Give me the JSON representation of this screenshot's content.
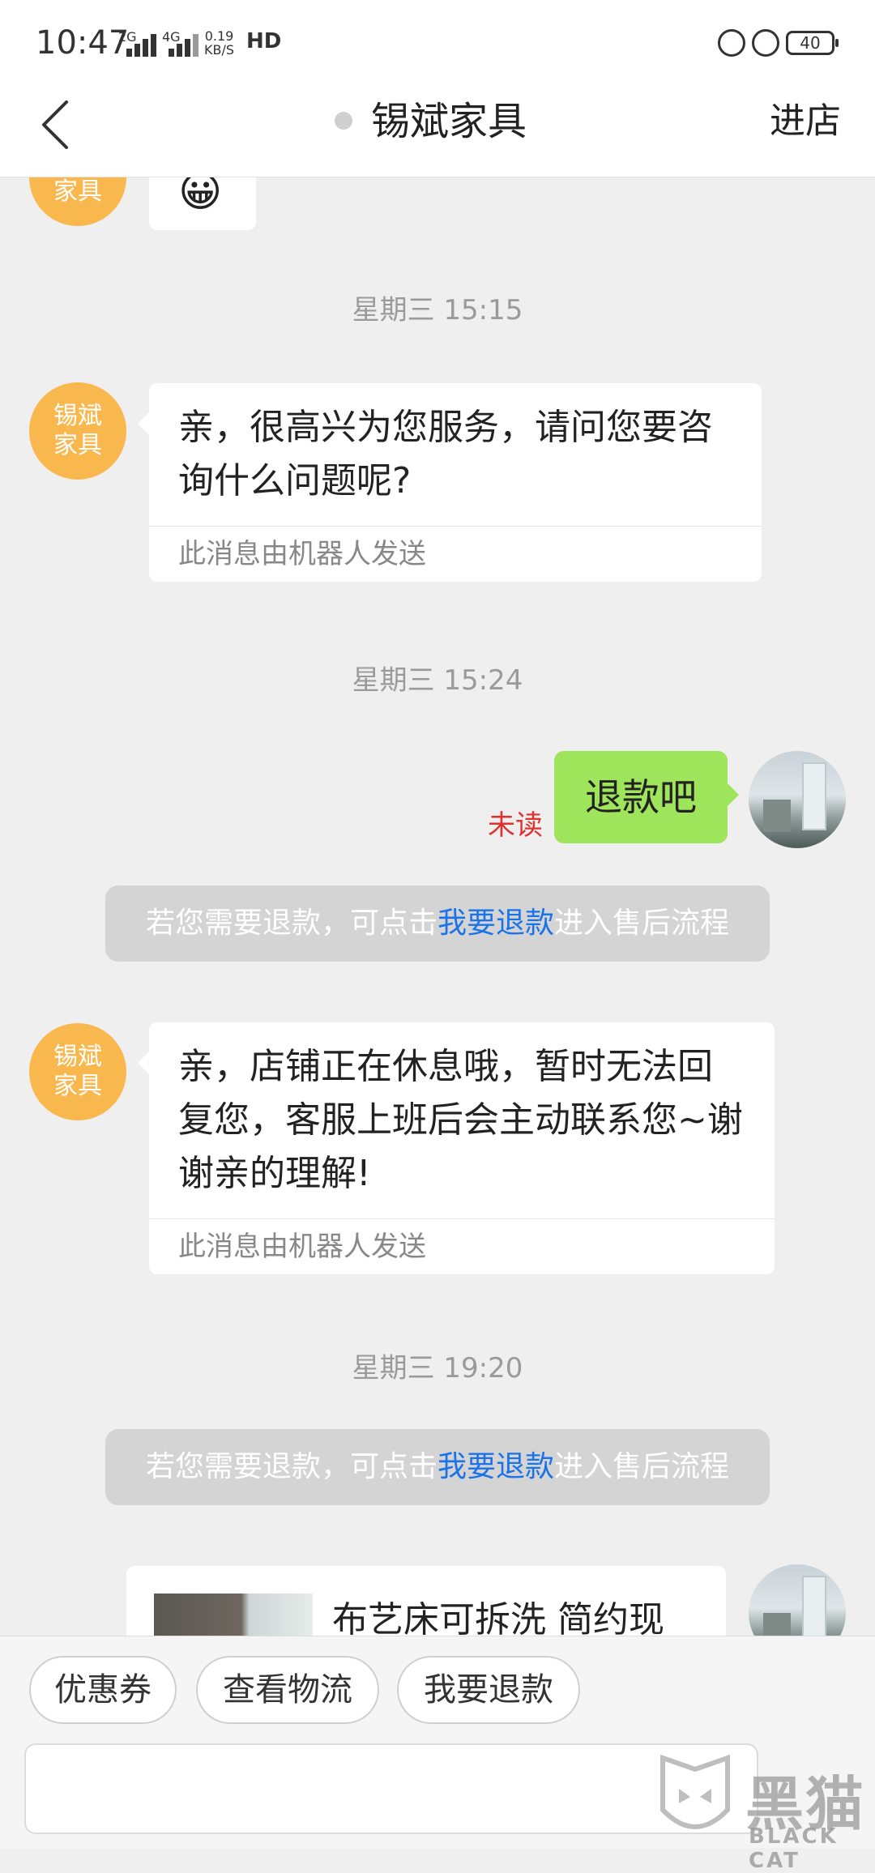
{
  "status_bar": {
    "time": "10:47",
    "sig1_label": "2G",
    "sig2_label": "4G",
    "speed_value": "0.19",
    "speed_unit": "KB/S",
    "hd_label": "HD",
    "battery": "40"
  },
  "header": {
    "title": "锡斌家具",
    "enter_store": "进店"
  },
  "shop_avatar_label": "锡斌家具",
  "messages": {
    "emoji": "😀",
    "ts1": "星期三 15:15",
    "msg1": "亲，很高兴为您服务，请问您要咨询什么问题呢?",
    "msg1_foot": "此消息由机器人发送",
    "ts2": "星期三 15:24",
    "user_msg": "退款吧",
    "unread": "未读",
    "notice1_pre": "若您需要退款，可点击",
    "notice1_link": "我要退款",
    "notice1_post": "进入售后流程",
    "msg2": "亲，店铺正在休息哦，暂时无法回复您，客服上班后会主动联系您~谢谢亲的理解!",
    "msg2_foot": "此消息由机器人发送",
    "ts3": "星期三 19:20",
    "notice2_pre": "若您需要退款，可点击",
    "notice2_link": "我要退款",
    "notice2_post": "进入售后流程",
    "product_title": "布艺床可拆洗 简约现"
  },
  "quick_buttons": [
    "优惠券",
    "查看物流",
    "我要退款"
  ],
  "watermark": {
    "text": "黑猫",
    "sub": "BLACK CAT"
  },
  "colors": {
    "shop_avatar": "#f8b84e",
    "user_bubble": "#9ee55b",
    "link": "#1a73e8",
    "unread": "#e03131"
  }
}
